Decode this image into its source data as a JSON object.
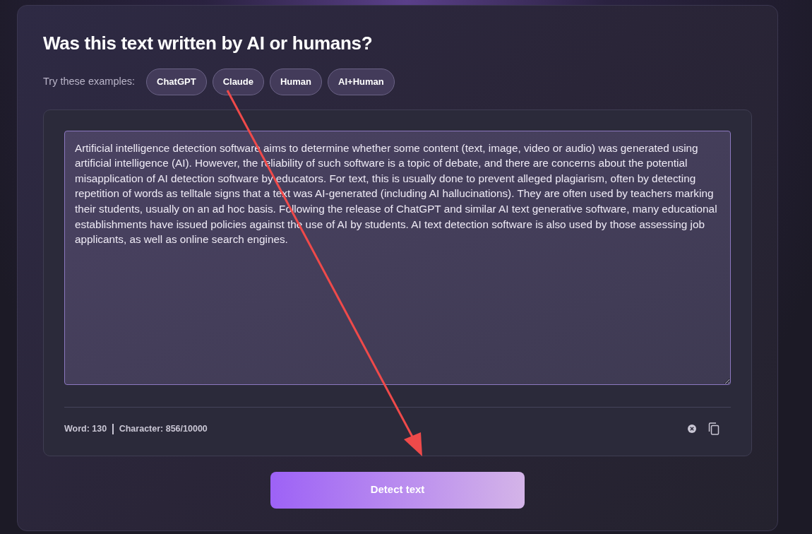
{
  "title": "Was this text written by AI or humans?",
  "examples": {
    "label": "Try these examples:",
    "chips": [
      "ChatGPT",
      "Claude",
      "Human",
      "AI+Human"
    ]
  },
  "editor": {
    "text": "Artificial intelligence detection software aims to determine whether some content (text, image, video or audio) was generated using artificial intelligence (AI). However, the reliability of such software is a topic of debate, and there are concerns about the potential misapplication of AI detection software by educators. For text, this is usually done to prevent alleged plagiarism, often by detecting repetition of words as telltale signs that a text was AI-generated (including AI hallucinations). They are often used by teachers marking their students, usually on an ad hoc basis. Following the release of ChatGPT and similar AI text generative software, many educational establishments have issued policies against the use of AI by students. AI text detection software is also used by those assessing job applicants, as well as online search engines.",
    "word_count": "Word: 130",
    "char_count": "Character: 856/10000"
  },
  "detect_button": "Detect text"
}
